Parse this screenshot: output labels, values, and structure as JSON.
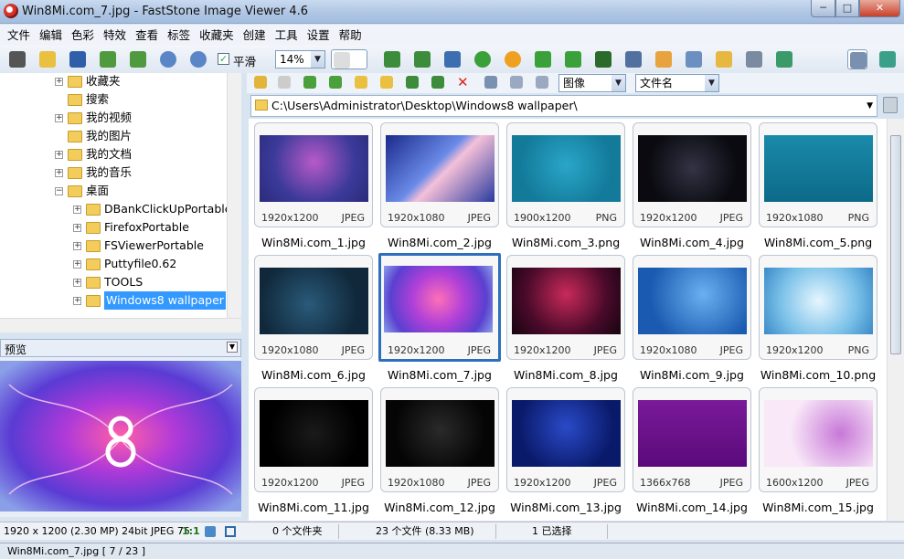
{
  "window": {
    "title": "Win8Mi.com_7.jpg  -  FastStone Image Viewer 4.6",
    "min": "─",
    "max": "□",
    "close": "✕"
  },
  "menu": [
    "文件",
    "编辑",
    "色彩",
    "特效",
    "查看",
    "标签",
    "收藏夹",
    "创建",
    "工具",
    "设置",
    "帮助"
  ],
  "toolbar": {
    "smooth_label": "平滑",
    "zoom_value": "14%"
  },
  "tree": [
    {
      "label": "收藏夹",
      "level": 1
    },
    {
      "label": "搜索",
      "level": 1
    },
    {
      "label": "我的视频",
      "level": 1
    },
    {
      "label": "我的图片",
      "level": 1
    },
    {
      "label": "我的文档",
      "level": 1
    },
    {
      "label": "我的音乐",
      "level": 1
    },
    {
      "label": "桌面",
      "level": 1
    },
    {
      "label": "DBankClickUpPortable",
      "level": 2
    },
    {
      "label": "FirefoxPortable",
      "level": 2
    },
    {
      "label": "FSViewerPortable",
      "level": 2
    },
    {
      "label": "Puttyfile0.62",
      "level": 2
    },
    {
      "label": "TOOLS",
      "level": 2
    },
    {
      "label": "Windows8 wallpaper",
      "level": 2,
      "selected": true
    }
  ],
  "preview": {
    "label": "预览",
    "info": "1920 x 1200 (2.30 MP)  24bit  JPEG   75",
    "ratio": "1:1"
  },
  "browser": {
    "filter_type": "图像",
    "sort_by": "文件名",
    "path": "C:\\Users\\Administrator\\Desktop\\Windows8 wallpaper\\",
    "thumbs": [
      {
        "name": "Win8Mi.com_1.jpg",
        "dims": "1920x1200",
        "fmt": "JPEG"
      },
      {
        "name": "Win8Mi.com_2.jpg",
        "dims": "1920x1080",
        "fmt": "JPEG"
      },
      {
        "name": "Win8Mi.com_3.png",
        "dims": "1900x1200",
        "fmt": "PNG"
      },
      {
        "name": "Win8Mi.com_4.jpg",
        "dims": "1920x1200",
        "fmt": "JPEG"
      },
      {
        "name": "Win8Mi.com_5.png",
        "dims": "1920x1080",
        "fmt": "PNG"
      },
      {
        "name": "Win8Mi.com_6.jpg",
        "dims": "1920x1080",
        "fmt": "JPEG"
      },
      {
        "name": "Win8Mi.com_7.jpg",
        "dims": "1920x1200",
        "fmt": "JPEG",
        "selected": true
      },
      {
        "name": "Win8Mi.com_8.jpg",
        "dims": "1920x1200",
        "fmt": "JPEG"
      },
      {
        "name": "Win8Mi.com_9.jpg",
        "dims": "1920x1080",
        "fmt": "JPEG"
      },
      {
        "name": "Win8Mi.com_10.png",
        "dims": "1920x1200",
        "fmt": "PNG"
      },
      {
        "name": "Win8Mi.com_11.jpg",
        "dims": "1920x1200",
        "fmt": "JPEG"
      },
      {
        "name": "Win8Mi.com_12.jpg",
        "dims": "1920x1080",
        "fmt": "JPEG"
      },
      {
        "name": "Win8Mi.com_13.jpg",
        "dims": "1920x1200",
        "fmt": "JPEG"
      },
      {
        "name": "Win8Mi.com_14.jpg",
        "dims": "1366x768",
        "fmt": "JPEG"
      },
      {
        "name": "Win8Mi.com_15.jpg",
        "dims": "1600x1200",
        "fmt": "JPEG"
      }
    ]
  },
  "status": {
    "folders": "0 个文件夹",
    "files": "23 个文件 (8.33 MB)",
    "selected": "1 已选择"
  },
  "bottom": "Win8Mi.com_7.jpg [ 7 / 23 ]"
}
